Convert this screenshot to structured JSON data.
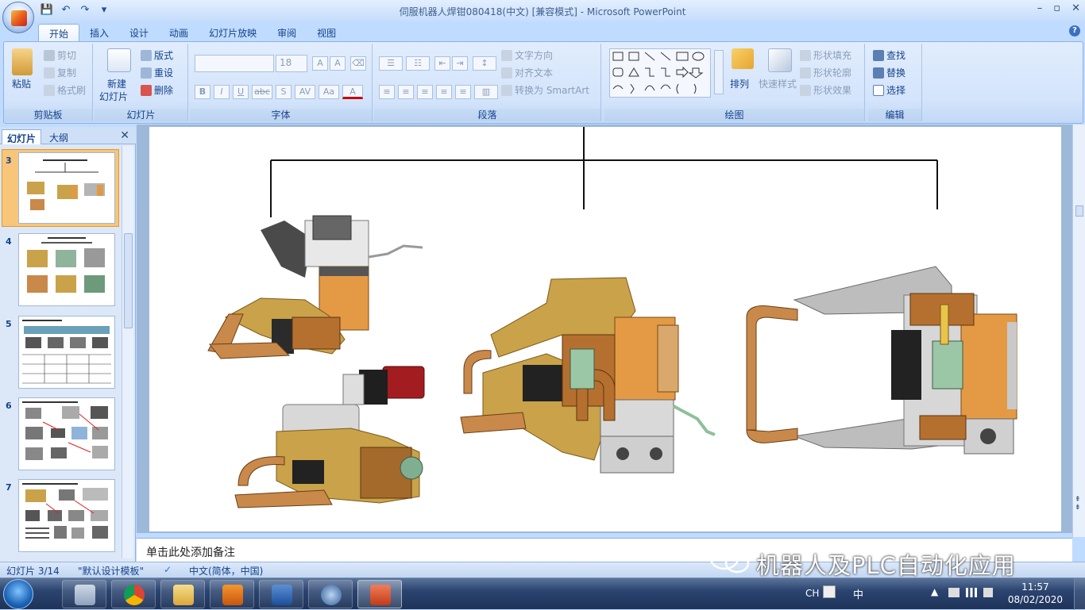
{
  "window": {
    "title": "伺服机器人焊钳080418(中文) [兼容模式] - Microsoft PowerPoint",
    "controls": [
      "–",
      "▫",
      "✕"
    ]
  },
  "qat": {
    "save": "💾",
    "undo": "↶",
    "redo": "↷",
    "more": "▾"
  },
  "tabs": [
    "开始",
    "插入",
    "设计",
    "动画",
    "幻灯片放映",
    "审阅",
    "视图"
  ],
  "ribbon": {
    "clipboard": {
      "label": "剪贴板",
      "paste": "粘贴",
      "cut": "剪切",
      "copy": "复制",
      "format_painter": "格式刷"
    },
    "slides": {
      "label": "幻灯片",
      "new_slide_1": "新建",
      "new_slide_2": "幻灯片",
      "layout": "版式",
      "reset": "重设",
      "delete": "删除"
    },
    "font": {
      "label": "字体",
      "font_name": "",
      "font_size": "18",
      "bold": "B",
      "italic": "I",
      "underline": "U",
      "strike": "abc",
      "shadow": "S",
      "spacing": "AV",
      "case": "Aa",
      "grow": "A",
      "shrink": "A"
    },
    "paragraph": {
      "label": "段落",
      "text_direction": "文字方向",
      "align_text": "对齐文本",
      "smartart": "转换为 SmartArt"
    },
    "drawing": {
      "label": "绘图",
      "arrange": "排列",
      "quick_styles": "快速样式",
      "fill": "形状填充",
      "outline": "形状轮廓",
      "effects": "形状效果"
    },
    "editing": {
      "label": "编辑",
      "find": "查找",
      "replace": "替换",
      "select": "选择"
    }
  },
  "panel": {
    "tab_slides": "幻灯片",
    "tab_outline": "大纲",
    "close": "✕",
    "thumbs": [
      {
        "num": "3",
        "selected": true
      },
      {
        "num": "4",
        "selected": false
      },
      {
        "num": "5",
        "selected": false
      },
      {
        "num": "6",
        "selected": false
      },
      {
        "num": "7",
        "selected": false
      }
    ]
  },
  "notes": {
    "placeholder": "单击此处添加备注"
  },
  "statusbar": {
    "slide_info": "幻灯片 3/14",
    "theme": "\"默认设计模板\"",
    "language": "中文(简体，中国)"
  },
  "watermark": {
    "text": "机器人及PLC自动化应用"
  },
  "taskbar": {
    "tray_lang": "CH",
    "tray_ime": "中",
    "time": "11:57",
    "date": "08/02/2020"
  },
  "colors": {
    "ribbon_bg": "#d4e4fb",
    "accent_orange": "#f2a241",
    "taskbar": "#1e3358",
    "copper": "#c8894a",
    "gold": "#c9a24a"
  }
}
